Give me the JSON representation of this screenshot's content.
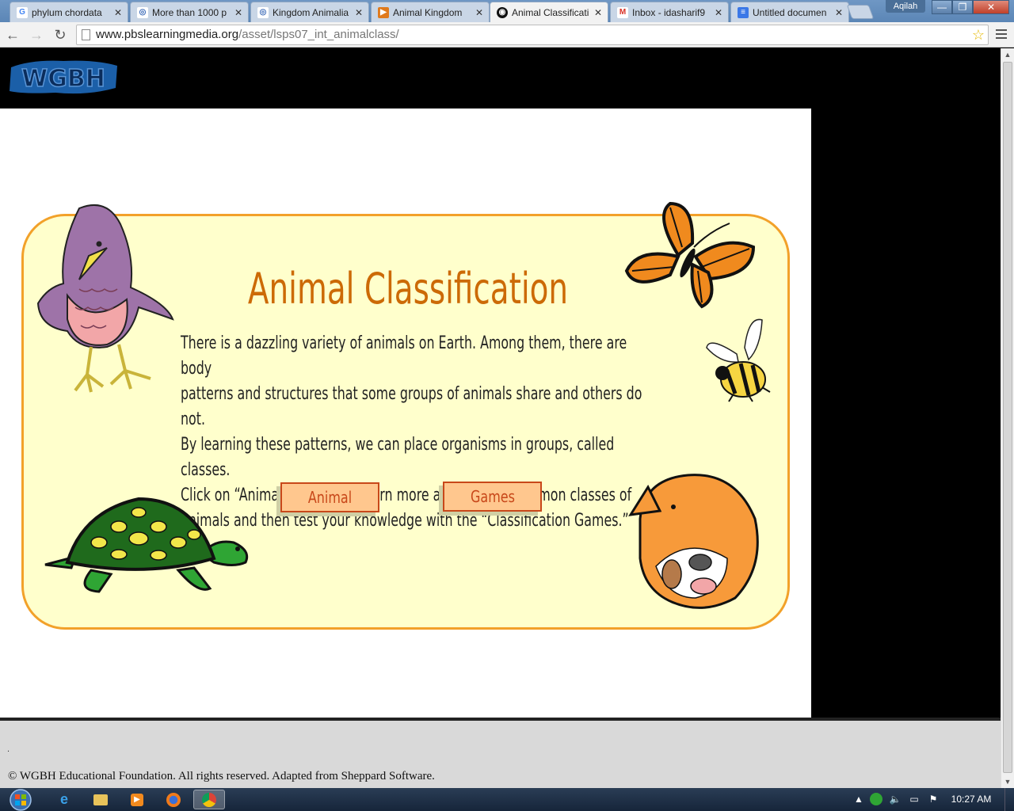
{
  "browser": {
    "tabs": [
      {
        "label": "phylum chordata",
        "favicon": "google-icon",
        "color": "#4285f4",
        "glyph": "G",
        "active": false
      },
      {
        "label": "More than 1000 p",
        "favicon": "globe-icon",
        "color": "#3a6ab8",
        "glyph": "◎",
        "active": false
      },
      {
        "label": "Kingdom Animalia",
        "favicon": "globe-icon",
        "color": "#3a6ab8",
        "glyph": "◎",
        "active": false
      },
      {
        "label": "Animal Kingdom",
        "favicon": "play-icon",
        "color": "#e07a1c",
        "glyph": "▶",
        "active": false
      },
      {
        "label": "Animal Classificati",
        "favicon": "pbs-icon",
        "color": "#111111",
        "glyph": "◉",
        "active": true
      },
      {
        "label": "Inbox - idasharif9",
        "favicon": "gmail-icon",
        "color": "#ffffff",
        "glyph": "M",
        "active": false
      },
      {
        "label": "Untitled documen",
        "favicon": "docs-icon",
        "color": "#3b78e7",
        "glyph": "≡",
        "active": false
      }
    ],
    "user_badge": "Aqilah",
    "window_buttons": {
      "minimize": "—",
      "maximize": "❐",
      "close": "✕"
    },
    "address": {
      "host": "www.pbslearningmedia.org",
      "path": "/asset/lsps07_int_animalclass/"
    },
    "nav": {
      "back": "←",
      "forward": "→",
      "reload": "↻"
    },
    "star": "☆"
  },
  "page": {
    "logo_text": "WGBH",
    "title": "Animal Classification",
    "intro_lines": [
      "There is a dazzling variety of animals on Earth. Among them, there are body",
      "patterns and structures that some groups of animals share and others do not.",
      "By learning these patterns, we can place organisms in groups, called classes.",
      "Click on “Animal Classes” to learn more about some common classes of",
      "animals and then test your knowledge with the “Classification Games.”"
    ],
    "buttons": {
      "animal_classes": "Animal Classes",
      "games": "Games"
    },
    "footer_dot": ".",
    "footer": "© WGBH Educational Foundation. All rights reserved. Adapted from Sheppard Software."
  },
  "taskbar": {
    "clock": "10:27 AM",
    "tray_up_arrow": "▲"
  },
  "colors": {
    "panel_fill": "#ffffcc",
    "panel_border": "#f2a12a",
    "title": "#cc6a06",
    "button_fill": "#ffc78e",
    "button_border": "#c8481a"
  }
}
